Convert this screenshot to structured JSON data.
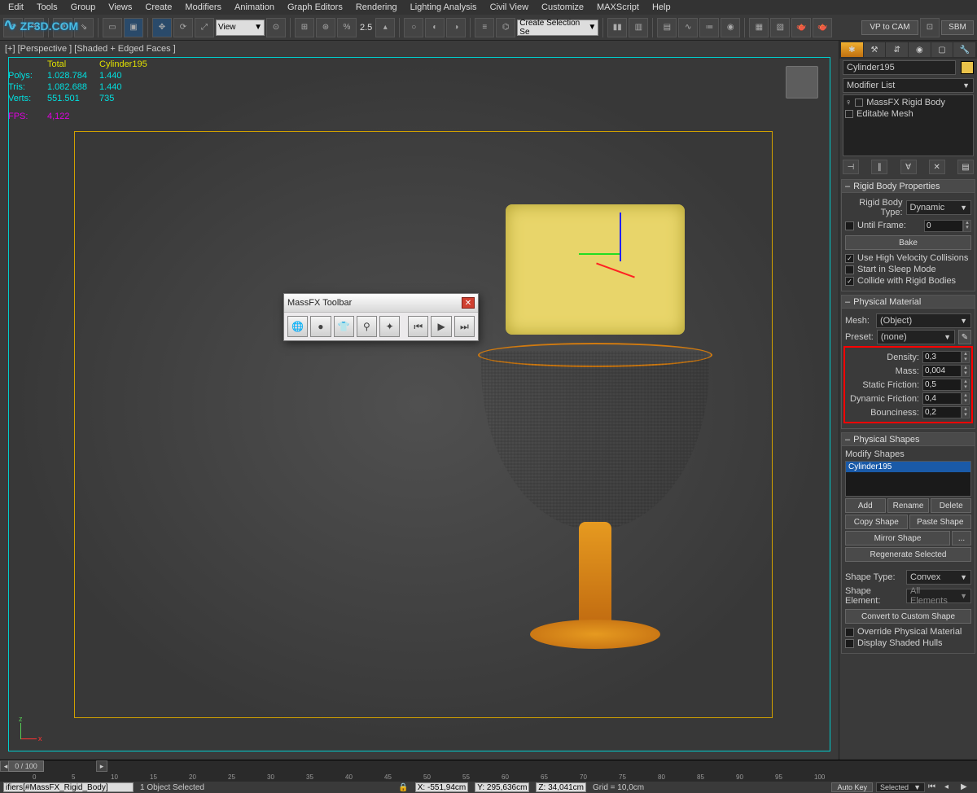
{
  "menubar": [
    "Edit",
    "Tools",
    "Group",
    "Views",
    "Create",
    "Modifiers",
    "Animation",
    "Graph Editors",
    "Rendering",
    "Lighting Analysis",
    "Civil View",
    "Customize",
    "MAXScript",
    "Help"
  ],
  "logo": "ZF3D.COM",
  "toolbar": {
    "view_dropdown": "View",
    "spinner": "2.5",
    "selset": "Create Selection Se",
    "vp_btn": "VP to CAM",
    "sbm_btn": "SBM"
  },
  "viewport": {
    "label": "[+] [Perspective ] [Shaded + Edged Faces ]",
    "stats": {
      "hdr_total": "Total",
      "hdr_obj": "Cylinder195",
      "polys_l": "Polys:",
      "polys_t": "1.028.784",
      "polys_o": "1.440",
      "tris_l": "Tris:",
      "tris_t": "1.082.688",
      "tris_o": "1.440",
      "verts_l": "Verts:",
      "verts_t": "551.501",
      "verts_o": "735",
      "fps_l": "FPS:",
      "fps_v": "4,122"
    }
  },
  "massfx": {
    "title": "MassFX Toolbar"
  },
  "panel": {
    "object_name": "Cylinder195",
    "modlist": "Modifier List",
    "stack": {
      "r0": "MassFX Rigid Body",
      "r1": "Editable Mesh"
    },
    "rigid": {
      "title": "Rigid Body Properties",
      "type_l": "Rigid Body Type:",
      "type_v": "Dynamic",
      "until_l": "Until Frame:",
      "until_v": "0",
      "bake": "Bake",
      "chk_hv": "Use High Velocity Collisions",
      "chk_sleep": "Start in Sleep Mode",
      "chk_collide": "Collide with Rigid Bodies"
    },
    "mat": {
      "title": "Physical Material",
      "mesh_l": "Mesh:",
      "mesh_v": "(Object)",
      "preset_l": "Preset:",
      "preset_v": "(none)",
      "density_l": "Density:",
      "density_v": "0,3",
      "mass_l": "Mass:",
      "mass_v": "0,004",
      "sfric_l": "Static Friction:",
      "sfric_v": "0,5",
      "dfric_l": "Dynamic Friction:",
      "dfric_v": "0,4",
      "bounce_l": "Bounciness:",
      "bounce_v": "0,2"
    },
    "shapes": {
      "title": "Physical Shapes",
      "modify": "Modify Shapes",
      "item0": "Cylinder195",
      "add": "Add",
      "rename": "Rename",
      "delete": "Delete",
      "copy": "Copy Shape",
      "paste": "Paste Shape",
      "mirror": "Mirror Shape",
      "dots": "...",
      "regen": "Regenerate Selected",
      "stype_l": "Shape Type:",
      "stype_v": "Convex",
      "selem_l": "Shape Element:",
      "selem_v": "All Elements",
      "convert": "Convert to Custom Shape",
      "chk_over": "Override Physical Material",
      "chk_hull": "Display Shaded Hulls"
    }
  },
  "timeline": {
    "frame": "0 / 100",
    "ticks": [
      "0",
      "5",
      "10",
      "15",
      "20",
      "25",
      "30",
      "35",
      "40",
      "45",
      "50",
      "55",
      "60",
      "65",
      "70",
      "75",
      "80",
      "85",
      "90",
      "95",
      "100"
    ]
  },
  "status": {
    "script": "ifiers[#MassFX_Rigid_Body]",
    "sel": "1 Object Selected",
    "x": "X: -551,94cm",
    "y": "Y: 295,636cm",
    "z": "Z: 34,041cm",
    "grid": "Grid = 10,0cm",
    "autokey": "Auto Key",
    "selected": "Selected"
  }
}
